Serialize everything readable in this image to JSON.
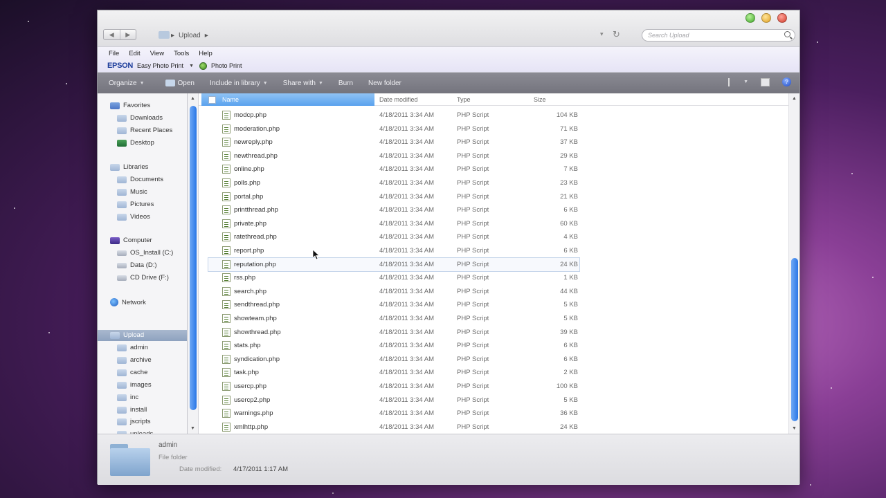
{
  "window": {
    "address": {
      "crumbs": [
        "Upload"
      ]
    },
    "search_placeholder": "Search Upload"
  },
  "menubar": {
    "items": [
      "File",
      "Edit",
      "View",
      "Tools",
      "Help"
    ],
    "epson_logo": "EPSON",
    "epson_app": "Easy Photo Print",
    "photo_print": "Photo Print"
  },
  "command_bar": {
    "organize": "Organize",
    "open": "Open",
    "include_in_library": "Include in library",
    "share_with": "Share with",
    "burn": "Burn",
    "new_folder": "New folder"
  },
  "nav": {
    "favorites": {
      "label": "Favorites",
      "items": [
        "Downloads",
        "Recent Places",
        "Desktop"
      ]
    },
    "libraries": {
      "label": "Libraries",
      "items": [
        "Documents",
        "Music",
        "Pictures",
        "Videos"
      ]
    },
    "computer": {
      "label": "Computer",
      "items": [
        "OS_Install (C:)",
        "Data (D:)",
        "CD Drive (F:)"
      ]
    },
    "network": "Network",
    "upload": {
      "label": "Upload",
      "items": [
        "admin",
        "archive",
        "cache",
        "images",
        "inc",
        "install",
        "jscripts",
        "uploads"
      ]
    }
  },
  "columns": {
    "name": "Name",
    "date": "Date modified",
    "type": "Type",
    "size": "Size"
  },
  "files": [
    {
      "name": "modcp.php",
      "date": "4/18/2011 3:34 AM",
      "type": "PHP Script",
      "size": "104 KB"
    },
    {
      "name": "moderation.php",
      "date": "4/18/2011 3:34 AM",
      "type": "PHP Script",
      "size": "71 KB"
    },
    {
      "name": "newreply.php",
      "date": "4/18/2011 3:34 AM",
      "type": "PHP Script",
      "size": "37 KB"
    },
    {
      "name": "newthread.php",
      "date": "4/18/2011 3:34 AM",
      "type": "PHP Script",
      "size": "29 KB"
    },
    {
      "name": "online.php",
      "date": "4/18/2011 3:34 AM",
      "type": "PHP Script",
      "size": "7 KB"
    },
    {
      "name": "polls.php",
      "date": "4/18/2011 3:34 AM",
      "type": "PHP Script",
      "size": "23 KB"
    },
    {
      "name": "portal.php",
      "date": "4/18/2011 3:34 AM",
      "type": "PHP Script",
      "size": "21 KB"
    },
    {
      "name": "printthread.php",
      "date": "4/18/2011 3:34 AM",
      "type": "PHP Script",
      "size": "6 KB"
    },
    {
      "name": "private.php",
      "date": "4/18/2011 3:34 AM",
      "type": "PHP Script",
      "size": "60 KB"
    },
    {
      "name": "ratethread.php",
      "date": "4/18/2011 3:34 AM",
      "type": "PHP Script",
      "size": "4 KB"
    },
    {
      "name": "report.php",
      "date": "4/18/2011 3:34 AM",
      "type": "PHP Script",
      "size": "6 KB"
    },
    {
      "name": "reputation.php",
      "date": "4/18/2011 3:34 AM",
      "type": "PHP Script",
      "size": "24 KB"
    },
    {
      "name": "rss.php",
      "date": "4/18/2011 3:34 AM",
      "type": "PHP Script",
      "size": "1 KB"
    },
    {
      "name": "search.php",
      "date": "4/18/2011 3:34 AM",
      "type": "PHP Script",
      "size": "44 KB"
    },
    {
      "name": "sendthread.php",
      "date": "4/18/2011 3:34 AM",
      "type": "PHP Script",
      "size": "5 KB"
    },
    {
      "name": "showteam.php",
      "date": "4/18/2011 3:34 AM",
      "type": "PHP Script",
      "size": "5 KB"
    },
    {
      "name": "showthread.php",
      "date": "4/18/2011 3:34 AM",
      "type": "PHP Script",
      "size": "39 KB"
    },
    {
      "name": "stats.php",
      "date": "4/18/2011 3:34 AM",
      "type": "PHP Script",
      "size": "6 KB"
    },
    {
      "name": "syndication.php",
      "date": "4/18/2011 3:34 AM",
      "type": "PHP Script",
      "size": "6 KB"
    },
    {
      "name": "task.php",
      "date": "4/18/2011 3:34 AM",
      "type": "PHP Script",
      "size": "2 KB"
    },
    {
      "name": "usercp.php",
      "date": "4/18/2011 3:34 AM",
      "type": "PHP Script",
      "size": "100 KB"
    },
    {
      "name": "usercp2.php",
      "date": "4/18/2011 3:34 AM",
      "type": "PHP Script",
      "size": "5 KB"
    },
    {
      "name": "warnings.php",
      "date": "4/18/2011 3:34 AM",
      "type": "PHP Script",
      "size": "36 KB"
    },
    {
      "name": "xmlhttp.php",
      "date": "4/18/2011 3:34 AM",
      "type": "PHP Script",
      "size": "24 KB"
    }
  ],
  "details": {
    "name": "admin",
    "type": "File folder",
    "modified_label": "Date modified:",
    "modified_value": "4/17/2011 1:17 AM"
  },
  "colors": {
    "accent": "#2a77e6",
    "cmdbar": "#7f7f88",
    "nav_selected": "#9aaec8"
  }
}
